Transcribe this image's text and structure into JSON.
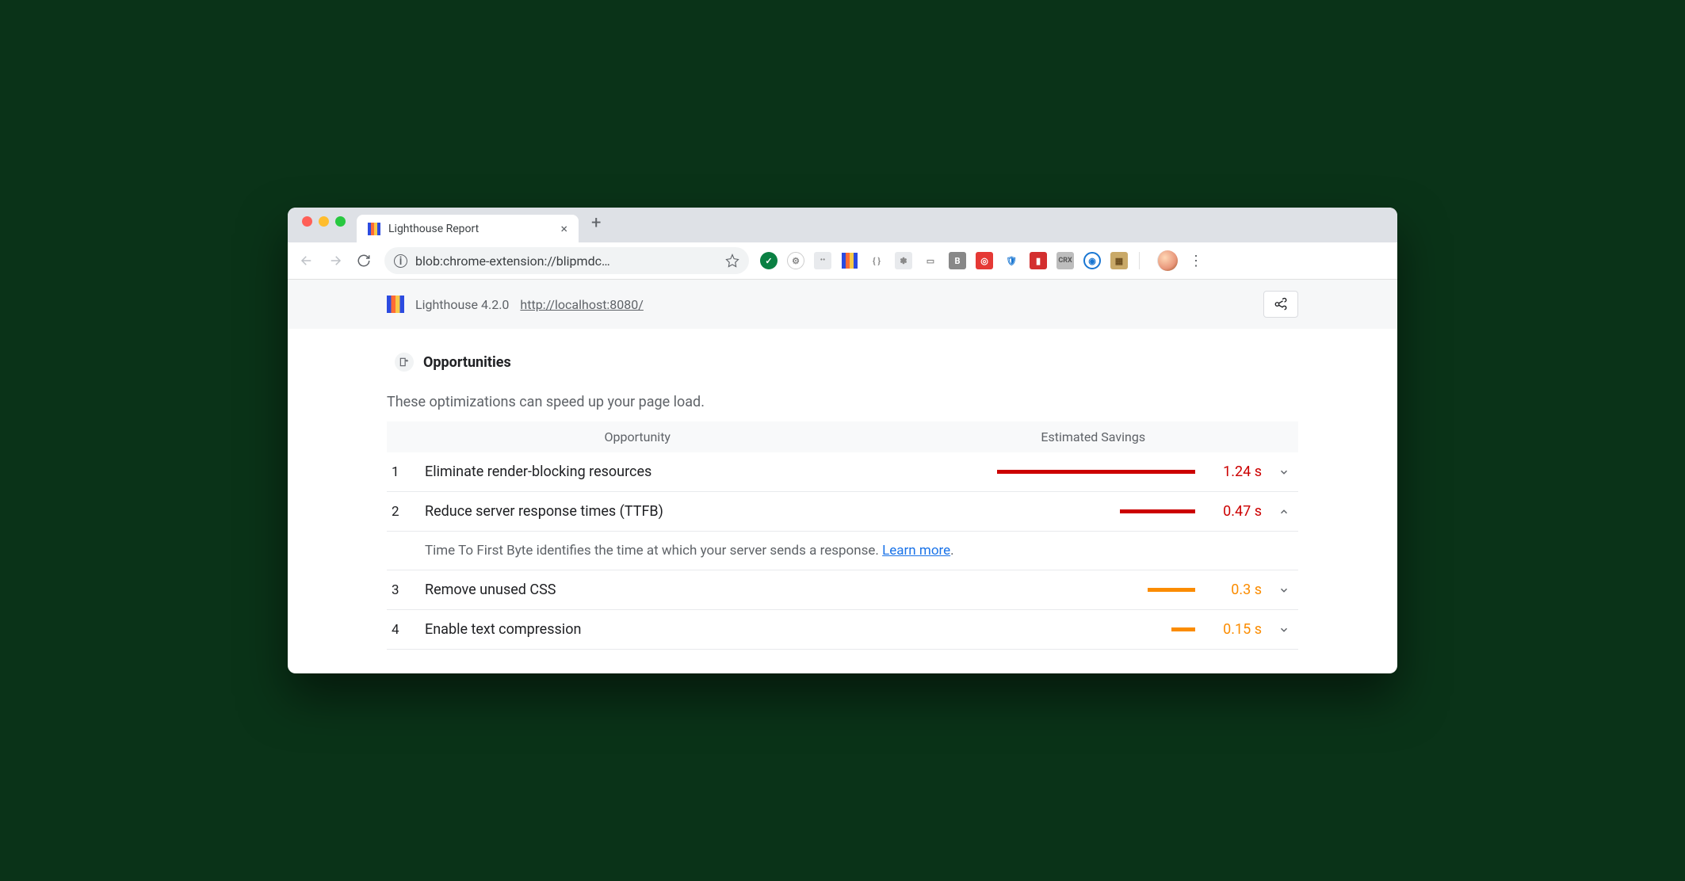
{
  "browser": {
    "tab_title": "Lighthouse Report",
    "url_display": "blob:chrome-extension://blipmdc…",
    "new_tab_label": "+"
  },
  "header": {
    "product": "Lighthouse 4.2.0",
    "tested_url": "http://localhost:8080/"
  },
  "opportunities": {
    "title": "Opportunities",
    "description": "These optimizations can speed up your page load.",
    "col_opportunity": "Opportunity",
    "col_savings": "Estimated Savings",
    "items": [
      {
        "num": "1",
        "label": "Eliminate render-blocking resources",
        "savings": "1.24 s",
        "severity": "red",
        "bar_pct": 100,
        "expanded": false
      },
      {
        "num": "2",
        "label": "Reduce server response times (TTFB)",
        "savings": "0.47 s",
        "severity": "red",
        "bar_pct": 38,
        "expanded": true,
        "detail_text": "Time To First Byte identifies the time at which your server sends a response. ",
        "detail_link": "Learn more",
        "detail_period": "."
      },
      {
        "num": "3",
        "label": "Remove unused CSS",
        "savings": "0.3 s",
        "severity": "orange",
        "bar_pct": 24,
        "expanded": false
      },
      {
        "num": "4",
        "label": "Enable text compression",
        "savings": "0.15 s",
        "severity": "orange",
        "bar_pct": 12,
        "expanded": false
      }
    ]
  },
  "colors": {
    "red": "#cc0000",
    "orange": "#fb8c00",
    "link": "#1a73e8"
  }
}
